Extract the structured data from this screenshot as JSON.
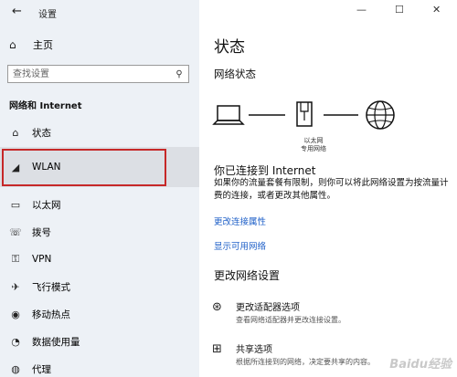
{
  "window": {
    "title": "设置",
    "back": "←",
    "minimize": "—",
    "maximize": "☐",
    "close": "✕"
  },
  "sidebar": {
    "home": {
      "icon": "⌂",
      "label": "主页"
    },
    "search_placeholder": "查找设置",
    "search_icon": "⚲",
    "section": "网络和 Internet",
    "items": [
      {
        "icon": "⌂",
        "label": "状态"
      },
      {
        "icon": "◢",
        "label": "WLAN"
      },
      {
        "icon": "▭",
        "label": "以太网"
      },
      {
        "icon": "☏",
        "label": "拨号"
      },
      {
        "icon": "⚿",
        "label": "VPN"
      },
      {
        "icon": "✈",
        "label": "飞行模式"
      },
      {
        "icon": "◉",
        "label": "移动热点"
      },
      {
        "icon": "◔",
        "label": "数据使用量"
      },
      {
        "icon": "◍",
        "label": "代理"
      }
    ]
  },
  "main": {
    "title": "状态",
    "network_status": "网络状态",
    "diagram_label1": "以太网",
    "diagram_label2": "专用网络",
    "connected_title": "你已连接到 Internet",
    "connected_desc": "如果你的流量套餐有限制，则你可以将此网络设置为按流量计费的连接，或者更改其他属性。",
    "link_change_props": "更改连接属性",
    "link_show_networks": "显示可用网络",
    "change_settings": "更改网络设置",
    "options": [
      {
        "icon": "⊛",
        "title": "更改适配器选项",
        "desc": "查看网络适配器并更改连接设置。"
      },
      {
        "icon": "⊞",
        "title": "共享选项",
        "desc": "根据所连接到的网络，决定要共享的内容。"
      }
    ],
    "watermark": "Baidu经验"
  }
}
